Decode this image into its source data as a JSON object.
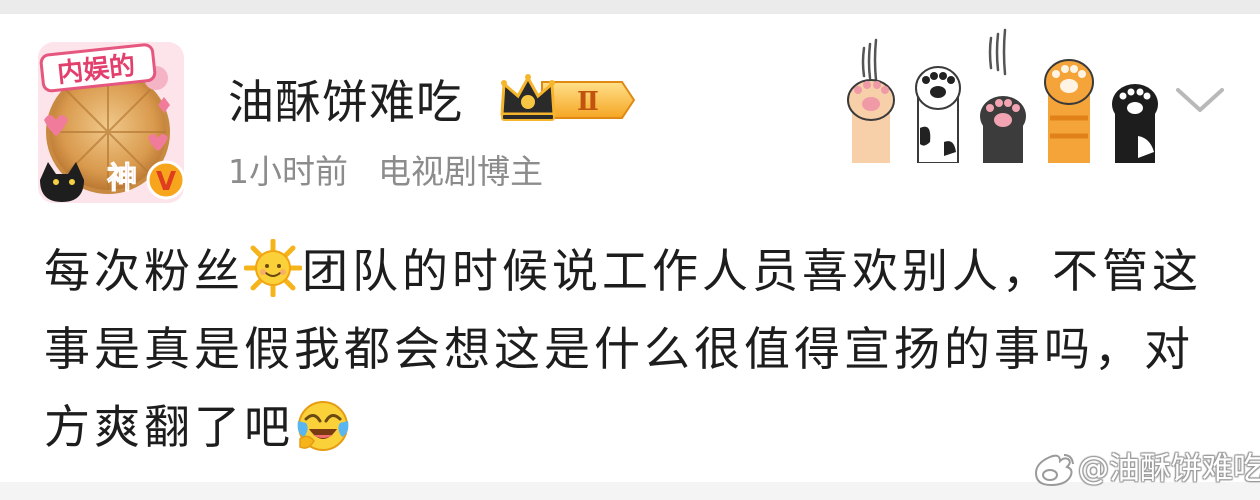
{
  "post": {
    "username": "油酥饼难吃",
    "badge_level": "Ⅱ",
    "timestamp": "1小时前",
    "user_title": "电视剧博主",
    "avatar_frame_text_top": "内娱的",
    "avatar_frame_text_bottom": "神",
    "verified_mark": "V",
    "content": {
      "part1": "每次粉丝",
      "emoji1": "sun-emoji",
      "part2": "团队的时候说工作人员喜欢别人，不管这事是真是假我都会想这是什么很值得宣扬的事吗，对方爽翻了吧",
      "emoji2": "laugh-cry-emoji"
    }
  },
  "watermark": {
    "text": "@油酥饼难吃",
    "logo": "weibo-logo-icon"
  },
  "colors": {
    "accent_gold": "#f5a623",
    "meta_gray": "#8c8c8c",
    "text": "#1d1d1d"
  }
}
